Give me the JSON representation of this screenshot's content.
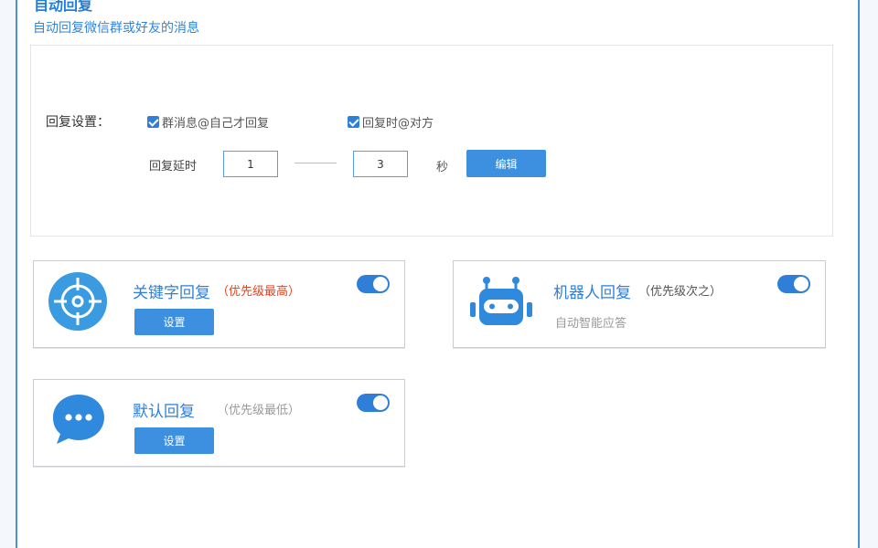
{
  "header": {
    "title": "自动回复",
    "subtitle": "自动回复微信群或好友的消息"
  },
  "reply_settings": {
    "label": "回复设置：",
    "option_group_at": "群消息@自己才回复",
    "option_at_sender": "回复时@对方",
    "delay_label": "回复延时",
    "delay_min": "1",
    "delay_max": "3",
    "delay_unit": "秒",
    "edit_button": "编辑"
  },
  "cards": {
    "keyword": {
      "title": "关键字回复",
      "priority": "（优先级最高）",
      "button": "设置",
      "enabled": true
    },
    "robot": {
      "title": "机器人回复",
      "priority": "（优先级次之）",
      "description": "自动智能应答",
      "enabled": true
    },
    "default": {
      "title": "默认回复",
      "priority": "（优先级最低）",
      "button": "设置",
      "enabled": true
    }
  },
  "colors": {
    "accent": "#2f7fd8",
    "priority_high": "#e8431f",
    "priority_mid": "#555555",
    "priority_low": "#9a9a9a"
  },
  "icons": {
    "keyword": "target-crosshair-icon",
    "robot": "robot-icon",
    "default": "chat-bubble-icon"
  }
}
